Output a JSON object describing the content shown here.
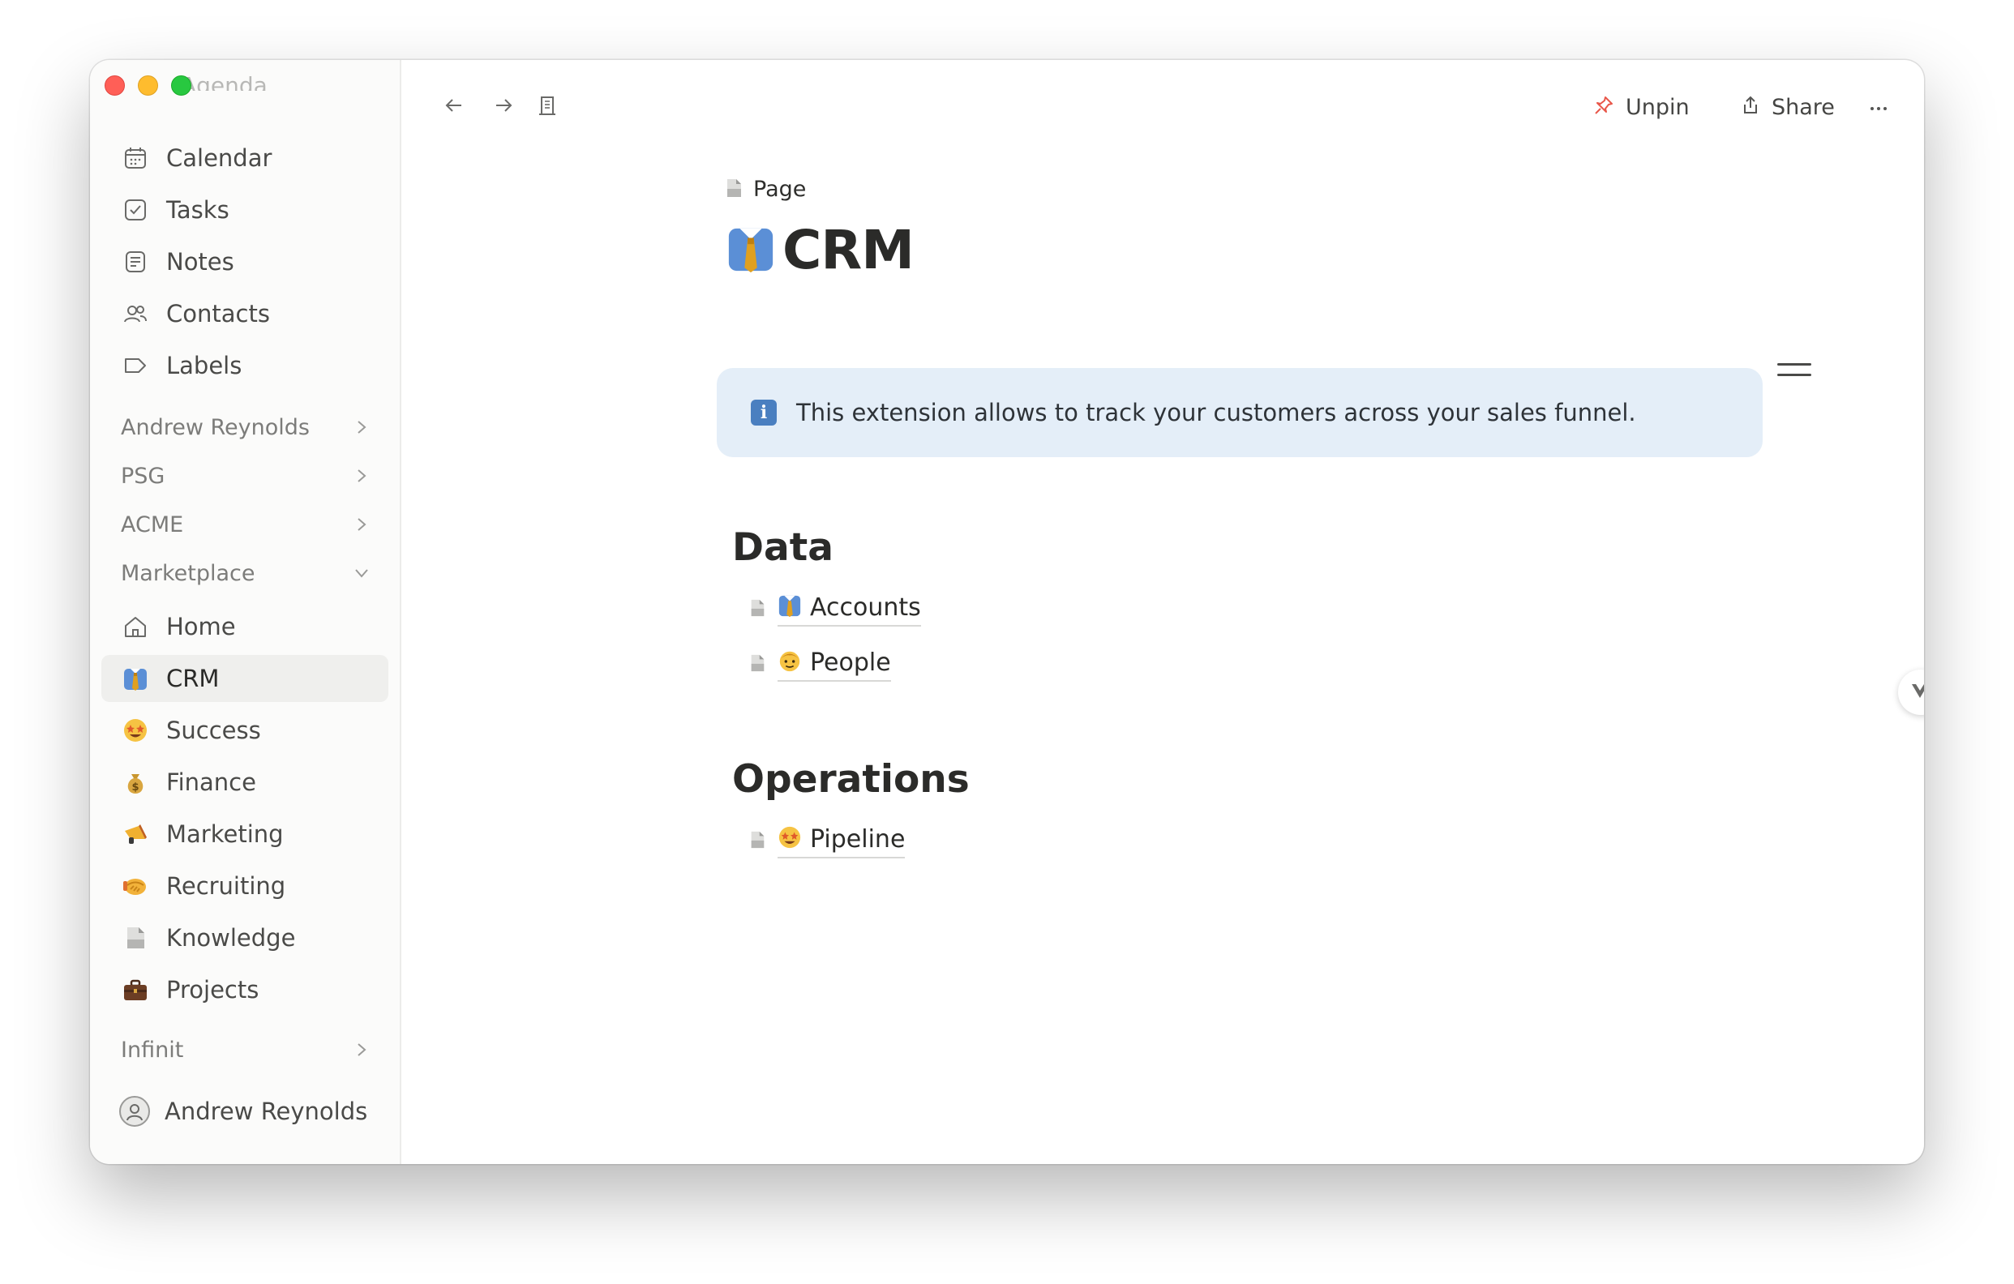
{
  "sidebar": {
    "agenda_label": "Agenda",
    "top_items": [
      {
        "label": "Calendar",
        "icon": "calendar-icon"
      },
      {
        "label": "Tasks",
        "icon": "check-square-icon"
      },
      {
        "label": "Notes",
        "icon": "note-icon"
      },
      {
        "label": "Contacts",
        "icon": "contacts-icon"
      },
      {
        "label": "Labels",
        "icon": "label-tag-icon"
      }
    ],
    "groups": [
      {
        "label": "Andrew Reynolds",
        "state": "collapsed"
      },
      {
        "label": "PSG",
        "state": "collapsed"
      },
      {
        "label": "ACME",
        "state": "collapsed"
      },
      {
        "label": "Marketplace",
        "state": "expanded"
      }
    ],
    "marketplace_items": [
      {
        "label": "Home",
        "icon": "home-icon"
      },
      {
        "label": "CRM",
        "icon": "necktie-emoji-icon",
        "active": true
      },
      {
        "label": "Success",
        "icon": "star-struck-emoji-icon"
      },
      {
        "label": "Finance",
        "icon": "money-bag-emoji-icon"
      },
      {
        "label": "Marketing",
        "icon": "megaphone-emoji-icon"
      },
      {
        "label": "Recruiting",
        "icon": "handshake-emoji-icon"
      },
      {
        "label": "Knowledge",
        "icon": "document-icon"
      },
      {
        "label": "Projects",
        "icon": "briefcase-emoji-icon"
      }
    ],
    "bottom_group": {
      "label": "Infinit",
      "state": "collapsed"
    },
    "user": {
      "name": "Andrew Reynolds"
    }
  },
  "topbar": {
    "unpin_label": "Unpin",
    "share_label": "Share"
  },
  "page": {
    "breadcrumb": "Page",
    "title": "CRM",
    "callout_text": "This extension allows to track your customers across your sales funnel.",
    "sections": [
      {
        "heading": "Data",
        "links": [
          {
            "label": "Accounts",
            "icon": "necktie-emoji-icon"
          },
          {
            "label": "People",
            "icon": "person-emoji-icon"
          }
        ]
      },
      {
        "heading": "Operations",
        "links": [
          {
            "label": "Pipeline",
            "icon": "star-struck-emoji-icon"
          }
        ]
      }
    ]
  },
  "colors": {
    "accent_pin": "#e8574a",
    "callout_bg": "#e4eef8",
    "active_item_bg": "#efefed"
  }
}
